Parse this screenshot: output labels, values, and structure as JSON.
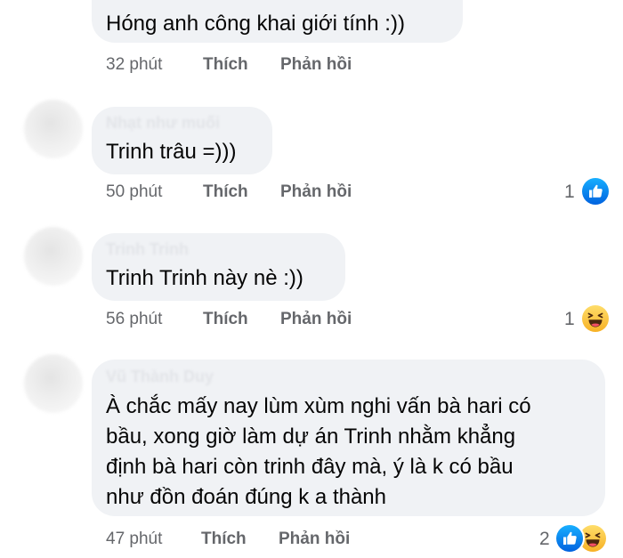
{
  "comments": [
    {
      "author": "",
      "text_lines": [
        "Hóng anh công khai giới tính :))"
      ],
      "time": "32 phút",
      "like_label": "Thích",
      "reply_label": "Phản hồi",
      "reaction_count": "",
      "reactions": []
    },
    {
      "author": "Nhạt như muối",
      "text_lines": [
        "Trinh trâu =)))"
      ],
      "time": "50 phút",
      "like_label": "Thích",
      "reply_label": "Phản hồi",
      "reaction_count": "1",
      "reactions": [
        "like-icon"
      ]
    },
    {
      "author": "Trinh Trinh",
      "text_lines": [
        "Trinh Trinh này nè :))"
      ],
      "time": "56 phút",
      "like_label": "Thích",
      "reply_label": "Phản hồi",
      "reaction_count": "1",
      "reactions": [
        "haha-icon"
      ]
    },
    {
      "author": "Vũ Thành Duy",
      "text_lines": [
        "À chắc mấy nay lùm xùm nghi vấn bà hari có",
        "bầu, xong giờ làm dự án Trinh nhằm khẳng",
        "định bà hari còn trinh đây mà, ý là k có bầu",
        "như đồn đoán đúng k a thành"
      ],
      "time": "47 phút",
      "like_label": "Thích",
      "reply_label": "Phản hồi",
      "reaction_count": "2",
      "reactions": [
        "like-icon",
        "haha-icon"
      ]
    }
  ],
  "colors": {
    "bubble": "#f0f2f5",
    "meta_text": "#65676b",
    "comment_text": "#050505",
    "like_blue": "#0866ff",
    "haha_yellow": "#f7b125"
  }
}
